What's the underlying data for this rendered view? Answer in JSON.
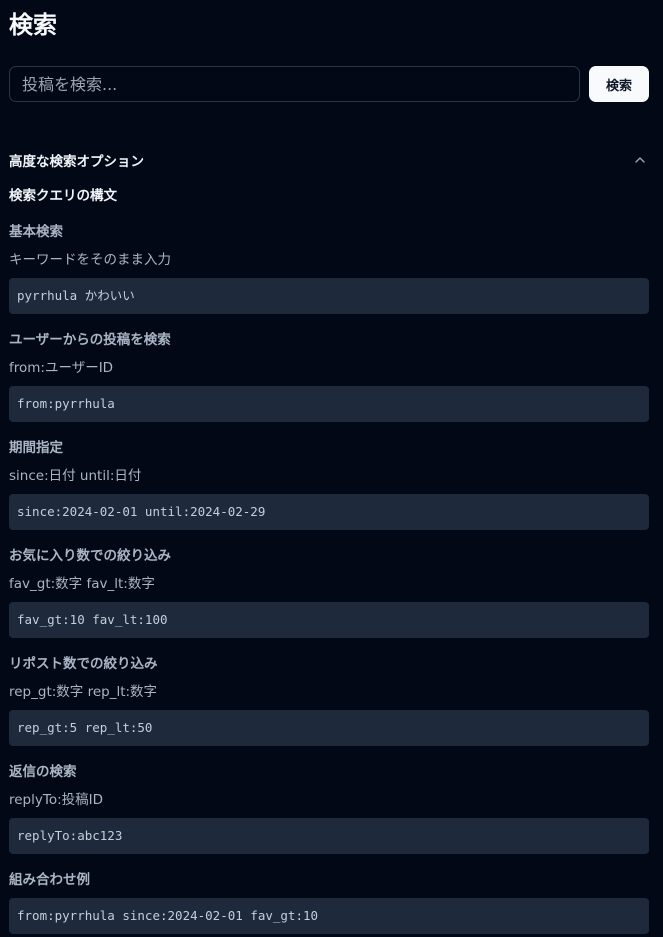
{
  "page": {
    "title": "検索"
  },
  "search": {
    "placeholder": "投稿を検索...",
    "value": "",
    "button_label": "検索"
  },
  "advanced": {
    "title": "高度な検索オプション",
    "expanded": true,
    "toggle_icon": "chevron-up-icon",
    "syntax_title": "検索クエリの構文",
    "sections": [
      {
        "title": "基本検索",
        "description": "キーワードをそのまま入力",
        "example": "pyrrhula かわいい"
      },
      {
        "title": "ユーザーからの投稿を検索",
        "description": "from:ユーザーID",
        "example": "from:pyrrhula"
      },
      {
        "title": "期間指定",
        "description": "since:日付 until:日付",
        "example": "since:2024-02-01 until:2024-02-29"
      },
      {
        "title": "お気に入り数での絞り込み",
        "description": "fav_gt:数字 fav_lt:数字",
        "example": "fav_gt:10 fav_lt:100"
      },
      {
        "title": "リポスト数での絞り込み",
        "description": "rep_gt:数字 rep_lt:数字",
        "example": "rep_gt:5 rep_lt:50"
      },
      {
        "title": "返信の検索",
        "description": "replyTo:投稿ID",
        "example": "replyTo:abc123"
      },
      {
        "title": "組み合わせ例",
        "description": "",
        "example": "from:pyrrhula since:2024-02-01 fav_gt:10"
      }
    ]
  },
  "colors": {
    "background": "#030816",
    "code_background": "#1e293b",
    "muted_text": "#a9b4c4",
    "button_background": "#f8fafc"
  }
}
